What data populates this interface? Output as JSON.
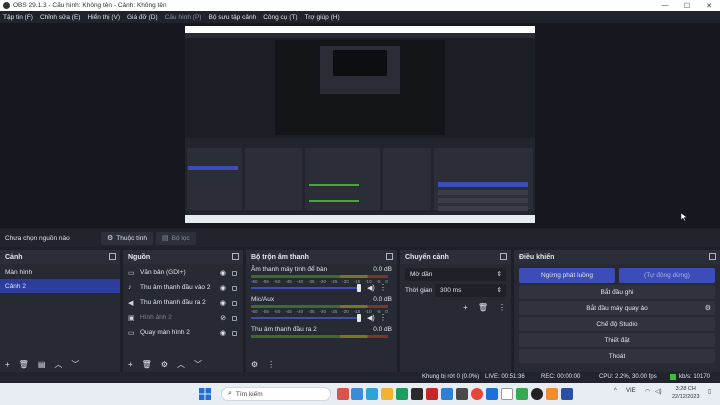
{
  "window": {
    "title": "OBS 29.1.3 - Cấu hình: Không tên - Cảnh: Không tên",
    "controls": [
      "—",
      "☐",
      "✕"
    ]
  },
  "menu": [
    "Tập tin (F)",
    "Chỉnh sửa (E)",
    "Hiển thị (V)",
    "Giá đỡ (D)",
    "Cấu hình (P)",
    "Bộ sưu tập cảnh",
    "Công cụ (T)",
    "Trợ giúp (H)"
  ],
  "source_toolbar": {
    "no_source": "Chưa chọn nguồn nào",
    "properties": "Thuộc tính",
    "filters": "Bộ lọc"
  },
  "scenes": {
    "title": "Cảnh",
    "items": [
      "Màn hình",
      "Cảnh 2"
    ],
    "selected": 1
  },
  "sources": {
    "title": "Nguồn",
    "items": [
      {
        "icon": "monitor-icon",
        "glyph": "▭",
        "label": "Văn bản (GDI+)",
        "dim": false
      },
      {
        "icon": "mic-icon",
        "glyph": "🎤",
        "label": "Thu âm thanh đầu vào 2",
        "dim": false
      },
      {
        "icon": "speaker-icon",
        "glyph": "🔊",
        "label": "Thu âm thanh đầu ra 2",
        "dim": false
      },
      {
        "icon": "image-icon",
        "glyph": "▣",
        "label": "Hình ảnh 2",
        "dim": true
      },
      {
        "icon": "monitor-icon",
        "glyph": "▭",
        "label": "Quay màn hình 2",
        "dim": false
      }
    ]
  },
  "mixer": {
    "title": "Bộ trộn âm thanh",
    "ticks": [
      "-60",
      "-55",
      "-50",
      "-45",
      "-40",
      "-35",
      "-30",
      "-25",
      "-20",
      "-15",
      "-10",
      "-5",
      "0"
    ],
    "channels": [
      {
        "name": "Âm thanh máy tính để bàn",
        "db": "0.0 dB"
      },
      {
        "name": "Mic/Aux",
        "db": "0.0 dB"
      },
      {
        "name": "Thu âm thanh đầu ra 2",
        "db": "0.0 dB"
      }
    ]
  },
  "transitions": {
    "title": "Chuyển cảnh",
    "selected": "Mờ dần",
    "duration_label": "Thời gian",
    "duration_value": "300 ms"
  },
  "controls": {
    "title": "Điều khiển",
    "stop_streaming": "Ngừng phát luồng",
    "auto_stop": "(Tự động dừng)",
    "start_recording": "Bắt đầu ghi",
    "start_virtual_cam": "Bắt đầu máy quay ảo",
    "studio_mode": "Chế độ Studio",
    "settings": "Thiết đặt",
    "exit": "Thoát"
  },
  "status": {
    "dropped": "Khung bị rớt 0 (0.0%)",
    "live": "LIVE: 00:51:36",
    "rec": "REC: 00:00:00",
    "cpu": "CPU: 2.2%, 30.00 fps",
    "bitrate": "kb/s: 10170"
  },
  "taskbar": {
    "search_placeholder": "Tìm kiếm",
    "lang": "VIE",
    "time": "3:28 CH",
    "date": "22/12/2023"
  },
  "colors": {
    "accent": "#3c4dba",
    "status_ok": "#3dbd3d",
    "dock_bg": "#272a33"
  }
}
